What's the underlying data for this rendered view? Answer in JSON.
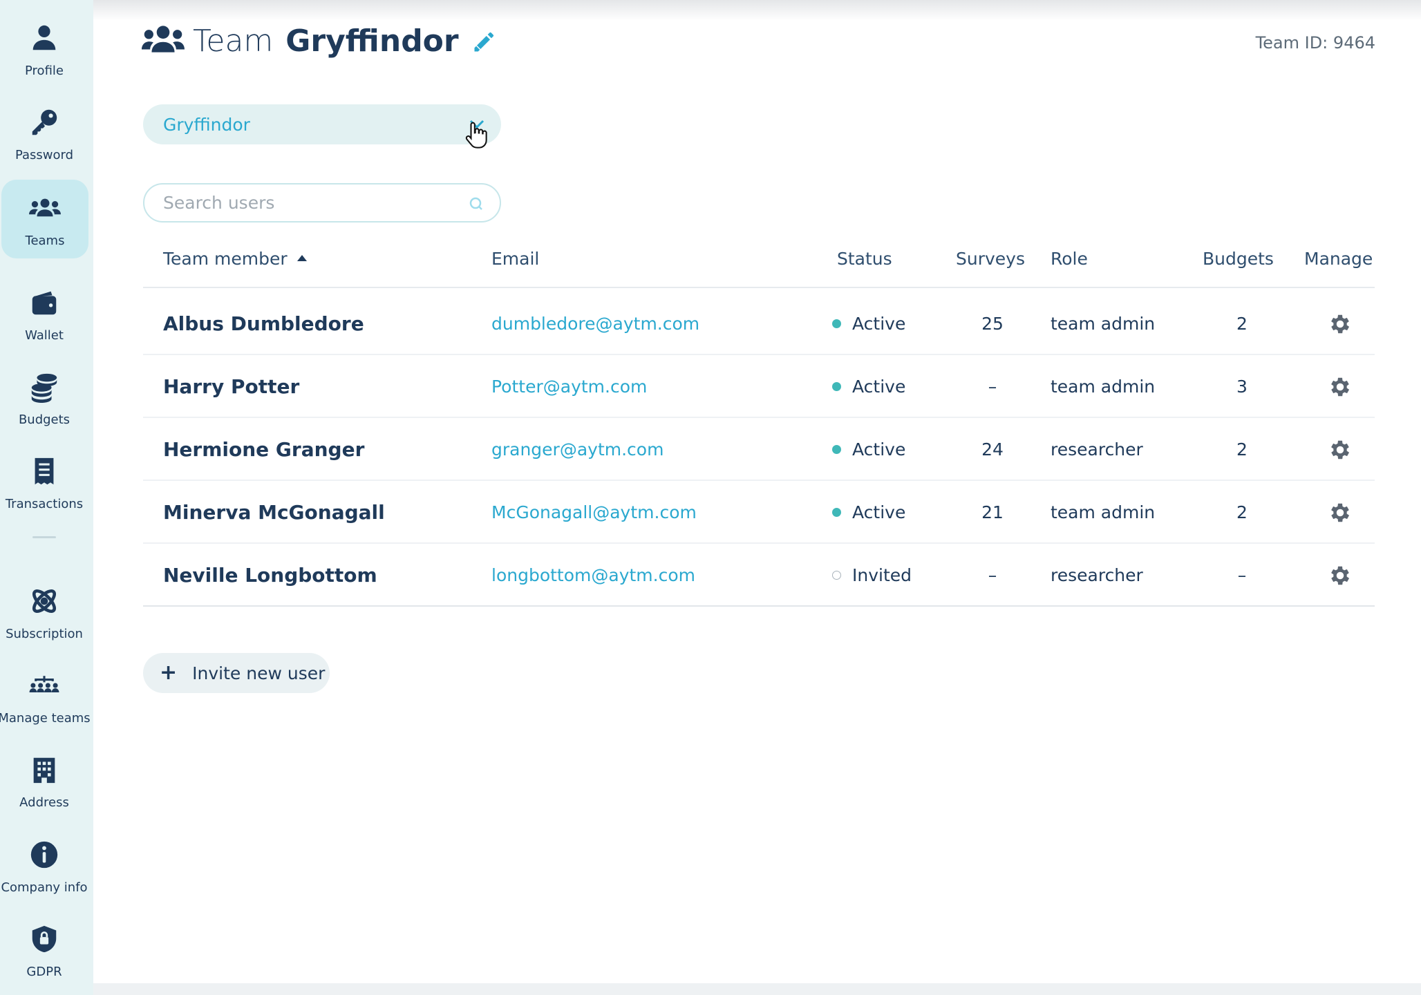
{
  "sidebar": {
    "items": [
      {
        "label": "Profile",
        "icon": "user-icon"
      },
      {
        "label": "Password",
        "icon": "key-icon"
      },
      {
        "label": "Teams",
        "icon": "users-icon",
        "active": true
      },
      {
        "label": "Wallet",
        "icon": "wallet-icon"
      },
      {
        "label": "Budgets",
        "icon": "coins-icon"
      },
      {
        "label": "Transactions",
        "icon": "receipt-icon"
      },
      {
        "label": "Subscription",
        "icon": "atom-icon"
      },
      {
        "label": "Manage teams",
        "icon": "team-structure-icon"
      },
      {
        "label": "Address",
        "icon": "building-icon"
      },
      {
        "label": "Company info",
        "icon": "info-icon"
      },
      {
        "label": "GDPR",
        "icon": "shield-lock-icon"
      }
    ]
  },
  "header": {
    "team_word": "Team",
    "team_name": "Gryffindor",
    "team_id_label": "Team ID:",
    "team_id_value": "9464"
  },
  "team_select": {
    "value": "Gryffindor"
  },
  "search": {
    "placeholder": "Search users",
    "value": ""
  },
  "table": {
    "columns": {
      "member": "Team member",
      "email": "Email",
      "status": "Status",
      "surveys": "Surveys",
      "role": "Role",
      "budgets": "Budgets",
      "manage": "Manage"
    },
    "rows": [
      {
        "name": "Albus Dumbledore",
        "email": "dumbledore@aytm.com",
        "status": "Active",
        "surveys": "25",
        "role": "team admin",
        "budgets": "2"
      },
      {
        "name": "Harry Potter",
        "email": "Potter@aytm.com",
        "status": "Active",
        "surveys": "–",
        "role": "team admin",
        "budgets": "3"
      },
      {
        "name": "Hermione Granger",
        "email": "granger@aytm.com",
        "status": "Active",
        "surveys": "24",
        "role": "researcher",
        "budgets": "2"
      },
      {
        "name": "Minerva McGonagall",
        "email": "McGonagall@aytm.com",
        "status": "Active",
        "surveys": "21",
        "role": "team admin",
        "budgets": "2"
      },
      {
        "name": "Neville Longbottom",
        "email": "longbottom@aytm.com",
        "status": "Invited",
        "surveys": "–",
        "role": "researcher",
        "budgets": "–"
      }
    ]
  },
  "invite": {
    "label": "Invite new user"
  },
  "colors": {
    "sidebar_bg": "#e6f3f4",
    "active_nav_bg": "#c8eaf0",
    "navy": "#1f3a5a",
    "link": "#2aa8cf",
    "status_active": "#3fb8b8"
  }
}
